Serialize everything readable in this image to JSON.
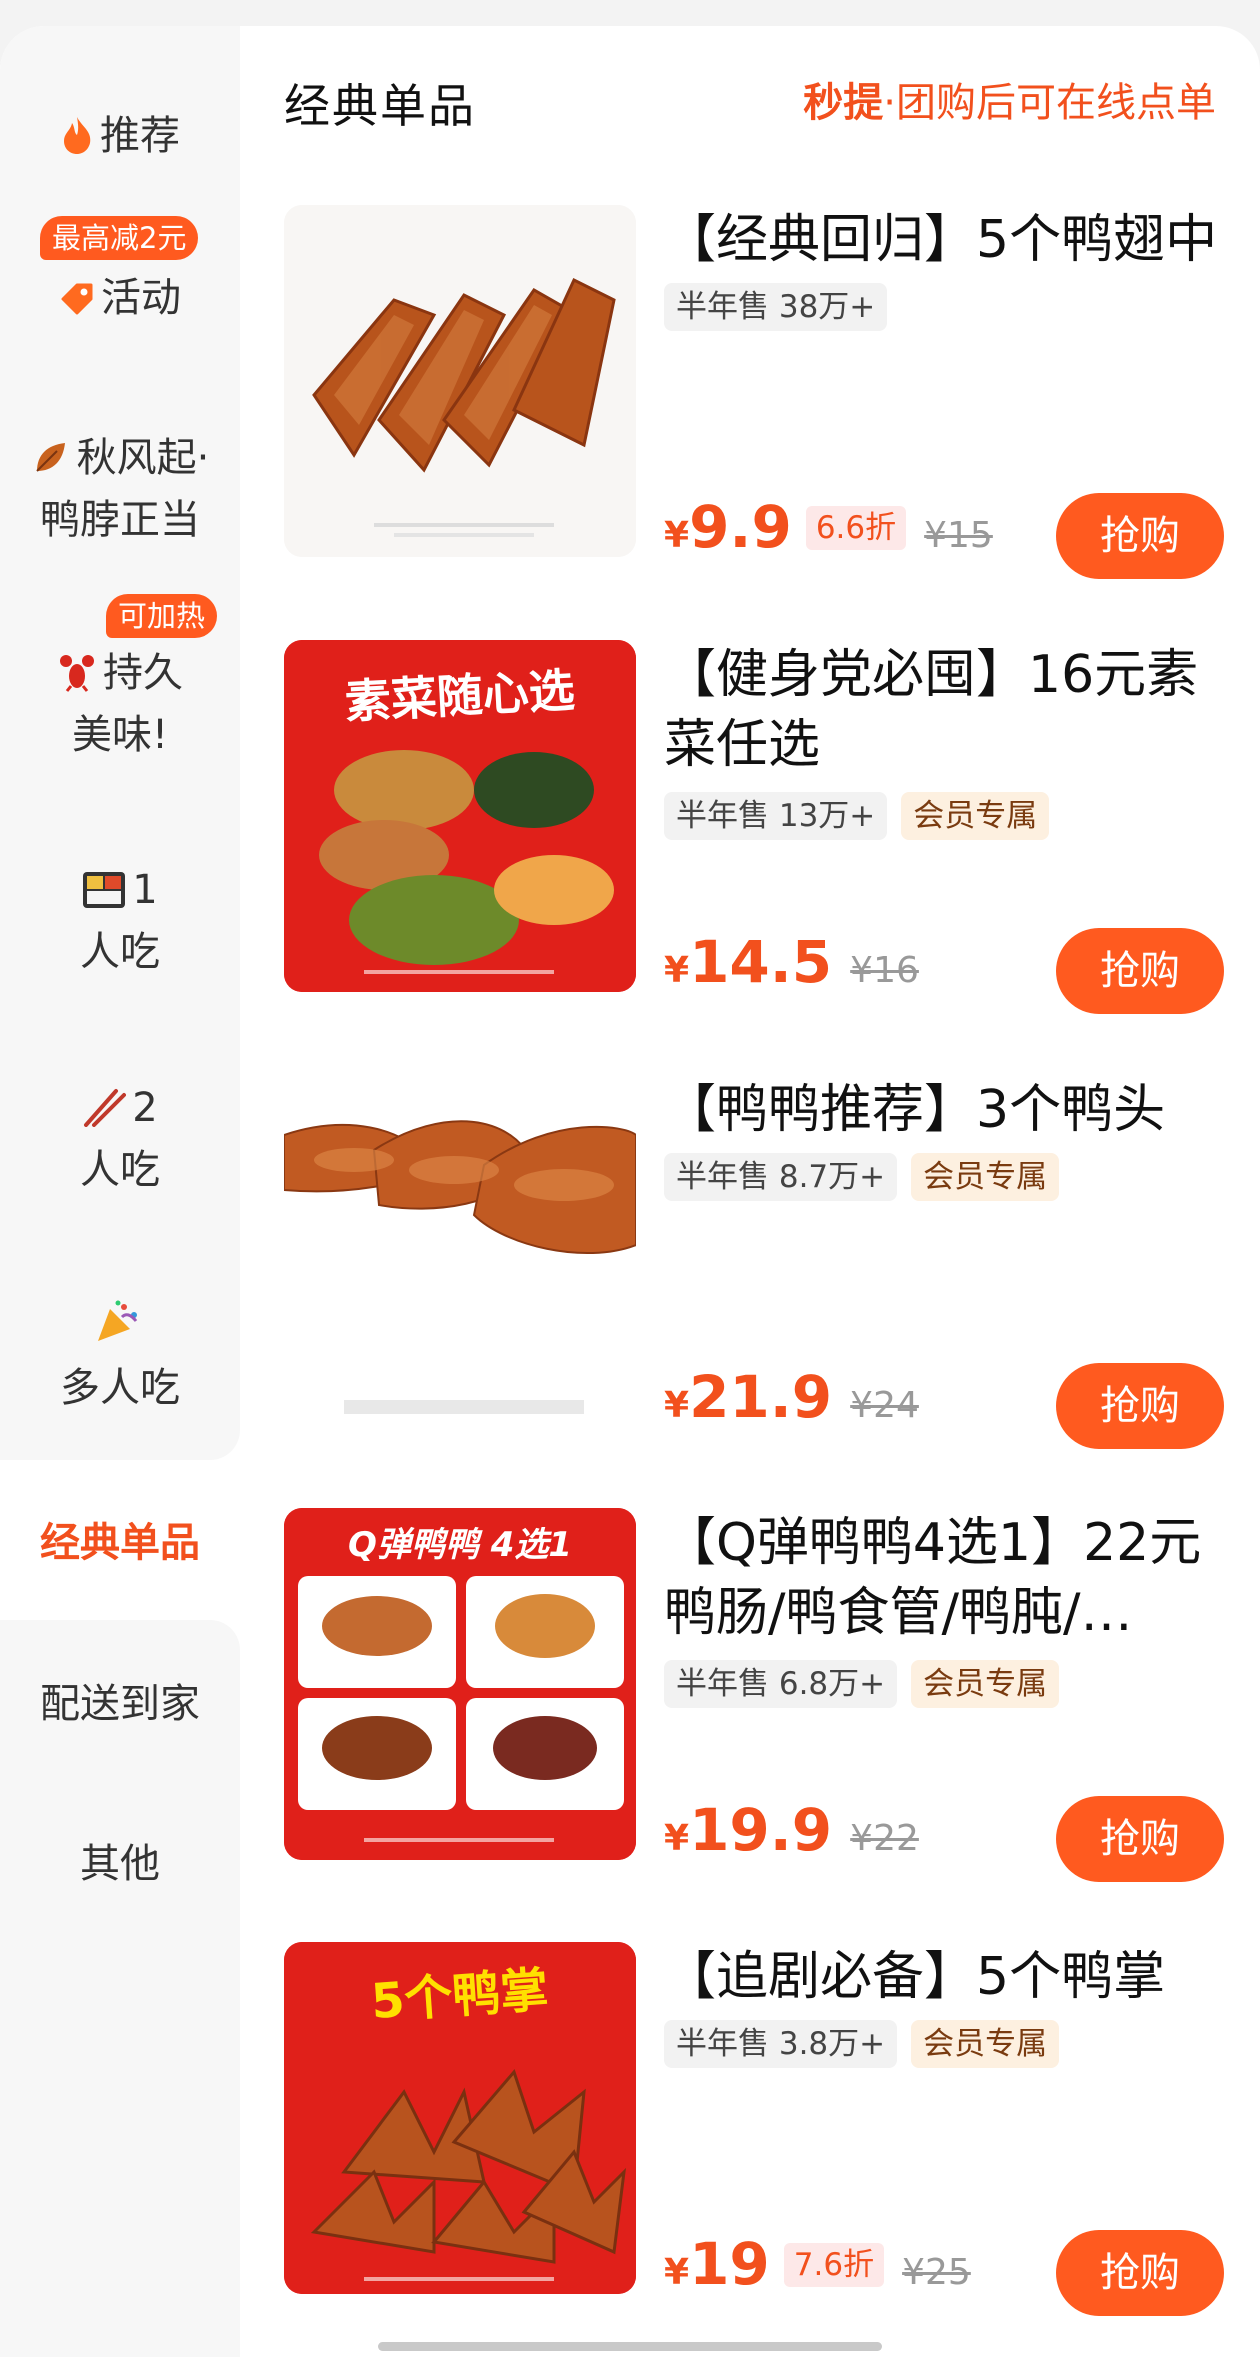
{
  "header": {
    "section_title": "经典单品",
    "notice_strong": "秒提",
    "notice_rest": "·团购后可在线点单"
  },
  "sidebar": {
    "items": [
      {
        "label": "推荐"
      },
      {
        "label": "活动",
        "badge": "最高减2元"
      },
      {
        "line1": "秋风起·",
        "line2": "鸭脖正当"
      },
      {
        "line1": "持久",
        "line2": "美味!",
        "badge": "可加热"
      },
      {
        "line1": "1",
        "line2": "人吃"
      },
      {
        "line1": "2",
        "line2": "人吃"
      },
      {
        "line2": "多人吃"
      },
      {
        "label": "经典单品"
      },
      {
        "label": "配送到家"
      },
      {
        "label": "其他"
      }
    ]
  },
  "products": [
    {
      "title": "【经典回归】5个鸭翅中",
      "sold": "半年售 38万+",
      "price_cur": "¥",
      "price_num": "9.9",
      "discount": "6.6折",
      "original": "¥15",
      "buy": "抢购"
    },
    {
      "title": "【健身党必囤】16元素菜任选",
      "image_text": "素菜随心选",
      "sold": "半年售 13万+",
      "member": "会员专属",
      "price_cur": "¥",
      "price_num": "14.5",
      "original": "¥16",
      "buy": "抢购"
    },
    {
      "title": "【鸭鸭推荐】3个鸭头",
      "sold": "半年售 8.7万+",
      "member": "会员专属",
      "price_cur": "¥",
      "price_num": "21.9",
      "original": "¥24",
      "buy": "抢购"
    },
    {
      "title": "【Q弹鸭鸭4选1】22元鸭肠/鸭食管/鸭肫/…",
      "image_text": "Q弹鸭鸭 4选1",
      "sold": "半年售 6.8万+",
      "member": "会员专属",
      "price_cur": "¥",
      "price_num": "19.9",
      "original": "¥22",
      "buy": "抢购"
    },
    {
      "title": "【追剧必备】5个鸭掌",
      "image_text": "5个鸭掌",
      "sold": "半年售 3.8万+",
      "member": "会员专属",
      "price_cur": "¥",
      "price_num": "19",
      "discount": "7.6折",
      "original": "¥25",
      "buy": "抢购"
    }
  ],
  "colors": {
    "accent": "#f2501d",
    "button": "#ff5a1f",
    "member_tag_bg": "#fdf0e0"
  }
}
